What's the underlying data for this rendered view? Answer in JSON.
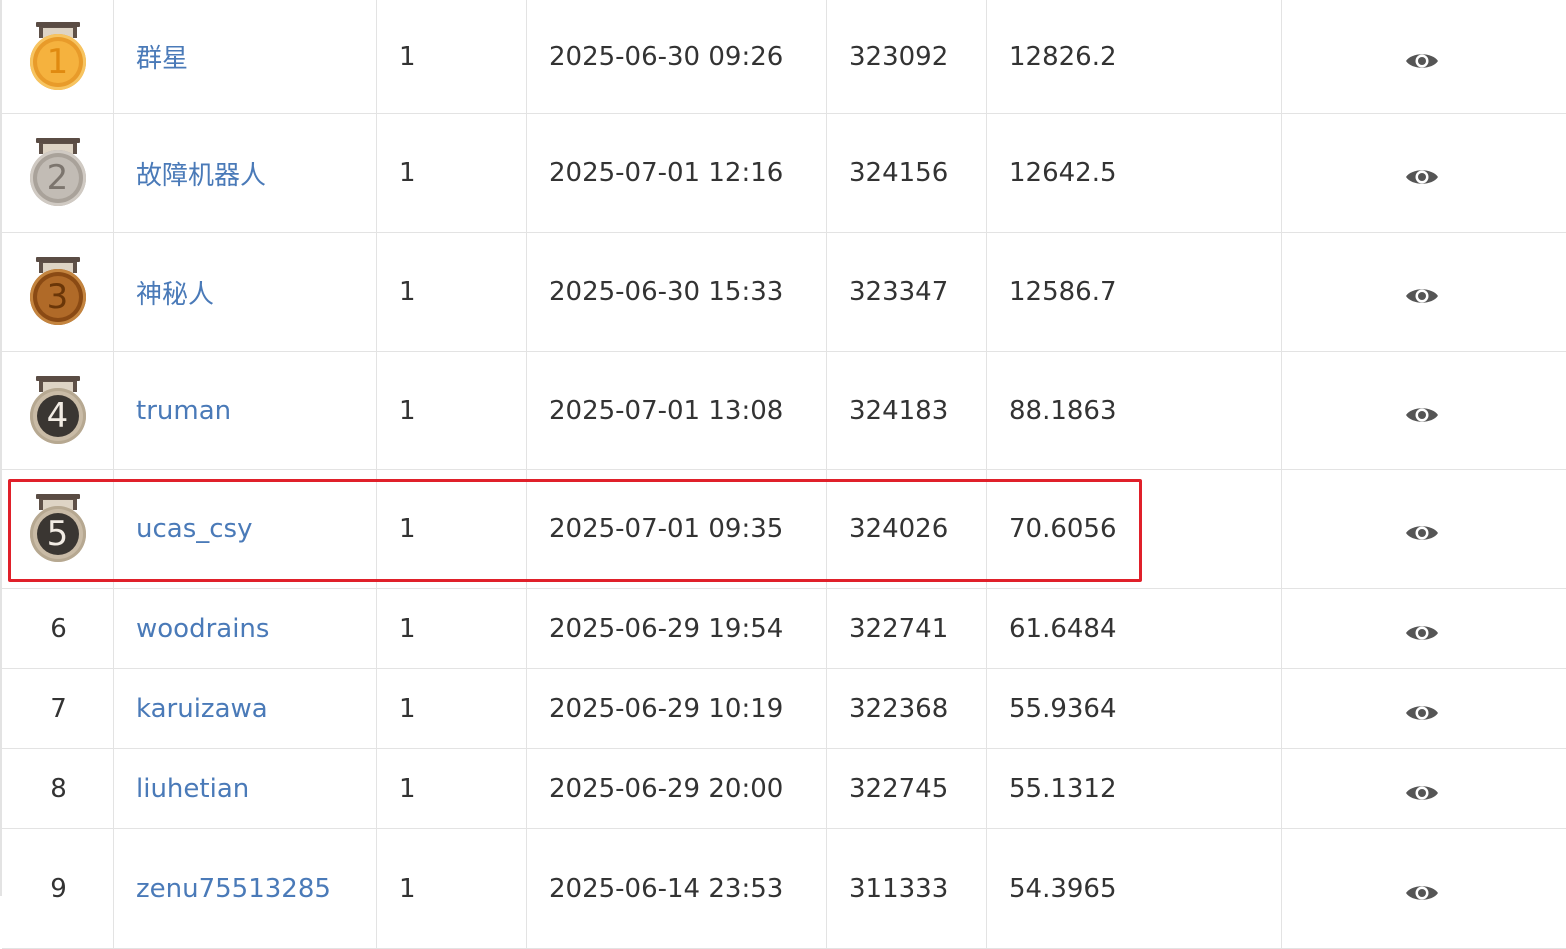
{
  "leaderboard": {
    "rows": [
      {
        "rank": "1",
        "medal": "gold-medal-icon",
        "name": "群星",
        "submissions": "1",
        "time": "2025-06-30 09:26",
        "id": "323092",
        "score": "12826.2",
        "action_icon": "eye-icon"
      },
      {
        "rank": "2",
        "medal": "silver-medal-icon",
        "name": "故障机器人",
        "submissions": "1",
        "time": "2025-07-01 12:16",
        "id": "324156",
        "score": "12642.5",
        "action_icon": "eye-icon"
      },
      {
        "rank": "3",
        "medal": "bronze-medal-icon",
        "name": "神秘人",
        "submissions": "1",
        "time": "2025-06-30 15:33",
        "id": "323347",
        "score": "12586.7",
        "action_icon": "eye-icon"
      },
      {
        "rank": "4",
        "medal": "dark-medal-icon",
        "name": "truman",
        "submissions": "1",
        "time": "2025-07-01 13:08",
        "id": "324183",
        "score": "88.1863",
        "action_icon": "eye-icon"
      },
      {
        "rank": "5",
        "medal": "dark-medal-icon",
        "name": "ucas_csy",
        "submissions": "1",
        "time": "2025-07-01 09:35",
        "id": "324026",
        "score": "70.6056",
        "action_icon": "eye-icon",
        "highlighted": true
      },
      {
        "rank": "6",
        "name": "woodrains",
        "submissions": "1",
        "time": "2025-06-29 19:54",
        "id": "322741",
        "score": "61.6484",
        "action_icon": "eye-icon"
      },
      {
        "rank": "7",
        "name": "karuizawa",
        "submissions": "1",
        "time": "2025-06-29 10:19",
        "id": "322368",
        "score": "55.9364",
        "action_icon": "eye-icon"
      },
      {
        "rank": "8",
        "name": "liuhetian",
        "submissions": "1",
        "time": "2025-06-29 20:00",
        "id": "322745",
        "score": "55.1312",
        "action_icon": "eye-icon"
      },
      {
        "rank": "9",
        "name": "zenu75513285",
        "submissions": "1",
        "time": "2025-06-14 23:53",
        "id": "311333",
        "score": "54.3965",
        "action_icon": "eye-icon"
      }
    ]
  },
  "colors": {
    "link": "#4a7ab8",
    "text": "#333333",
    "grid": "#e3e3e3",
    "highlight": "#e0202a",
    "gold": "#f0a436",
    "silver": "#b8b2ab",
    "bronze": "#9a5a1e",
    "dark": "#3a3632"
  }
}
